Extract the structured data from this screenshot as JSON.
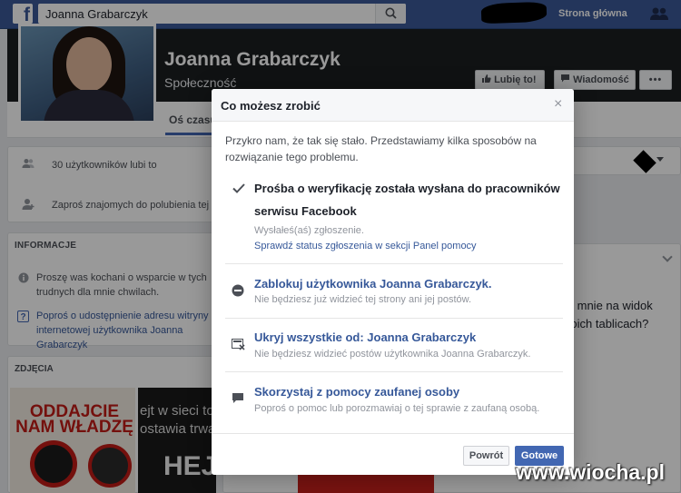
{
  "topbar": {
    "search_value": "Joanna Grabarczyk",
    "home_label": "Strona główna"
  },
  "page": {
    "name": "Joanna Grabarczyk",
    "category": "Społeczność",
    "like_button": "Lubię to!",
    "message_button": "Wiadomość",
    "more_button": "•••",
    "tab_timeline": "Oś czasu"
  },
  "left": {
    "likes_count": "30 użytkowników lubi to",
    "invite_text": "Zaproś znajomych do polubienia tej",
    "info_title": "INFORMACJE",
    "info_text": "Proszę was kochani o wsparcie w tych trudnych dla mnie chwilach.",
    "info_link": "Poproś o udostępnienie adresu witryny internetowej użytkownika Joanna Grabarczyk",
    "photos_title": "ZDJĘCIA",
    "photo1_text": "ODDAJCIE NAM WŁADZĘ",
    "photo2_text_a": "ejt w sieci to",
    "photo2_text_b": "ostawia trwały",
    "photo2_text_c": "HEJT"
  },
  "right": {
    "snippet": "dli mnie na widok woich tablicach?"
  },
  "dialog": {
    "title": "Co możesz zrobić",
    "close": "×",
    "intro": "Przykro nam, że tak się stało. Przedstawiamy kilka sposobów na rozwiązanie tego problemu.",
    "option1_title": "Prośba o weryfikację została wysłana do pracowników serwisu Facebook",
    "option1_sub": "Wysłałeś(aś) zgłoszenie.",
    "option1_link": "Sprawdź status zgłoszenia w sekcji Panel pomocy",
    "option2_title": "Zablokuj użytkownika Joanna Grabarczyk.",
    "option2_sub": "Nie będziesz już widzieć tej strony ani jej postów.",
    "option3_title": "Ukryj wszystkie od: Joanna Grabarczyk",
    "option3_sub": "Nie będziesz widzieć postów użytkownika Joanna Grabarczyk.",
    "option4_title": "Skorzystaj z pomocy zaufanej osoby",
    "option4_sub": "Poproś o pomoc lub porozmawiaj o tej sprawie z zaufaną osobą.",
    "back_button": "Powrót",
    "done_button": "Gotowe"
  },
  "watermark": "www.wiocha.pl",
  "colors": {
    "facebook_blue": "#3b5998",
    "link_blue": "#365899",
    "button_blue": "#4267b2"
  }
}
